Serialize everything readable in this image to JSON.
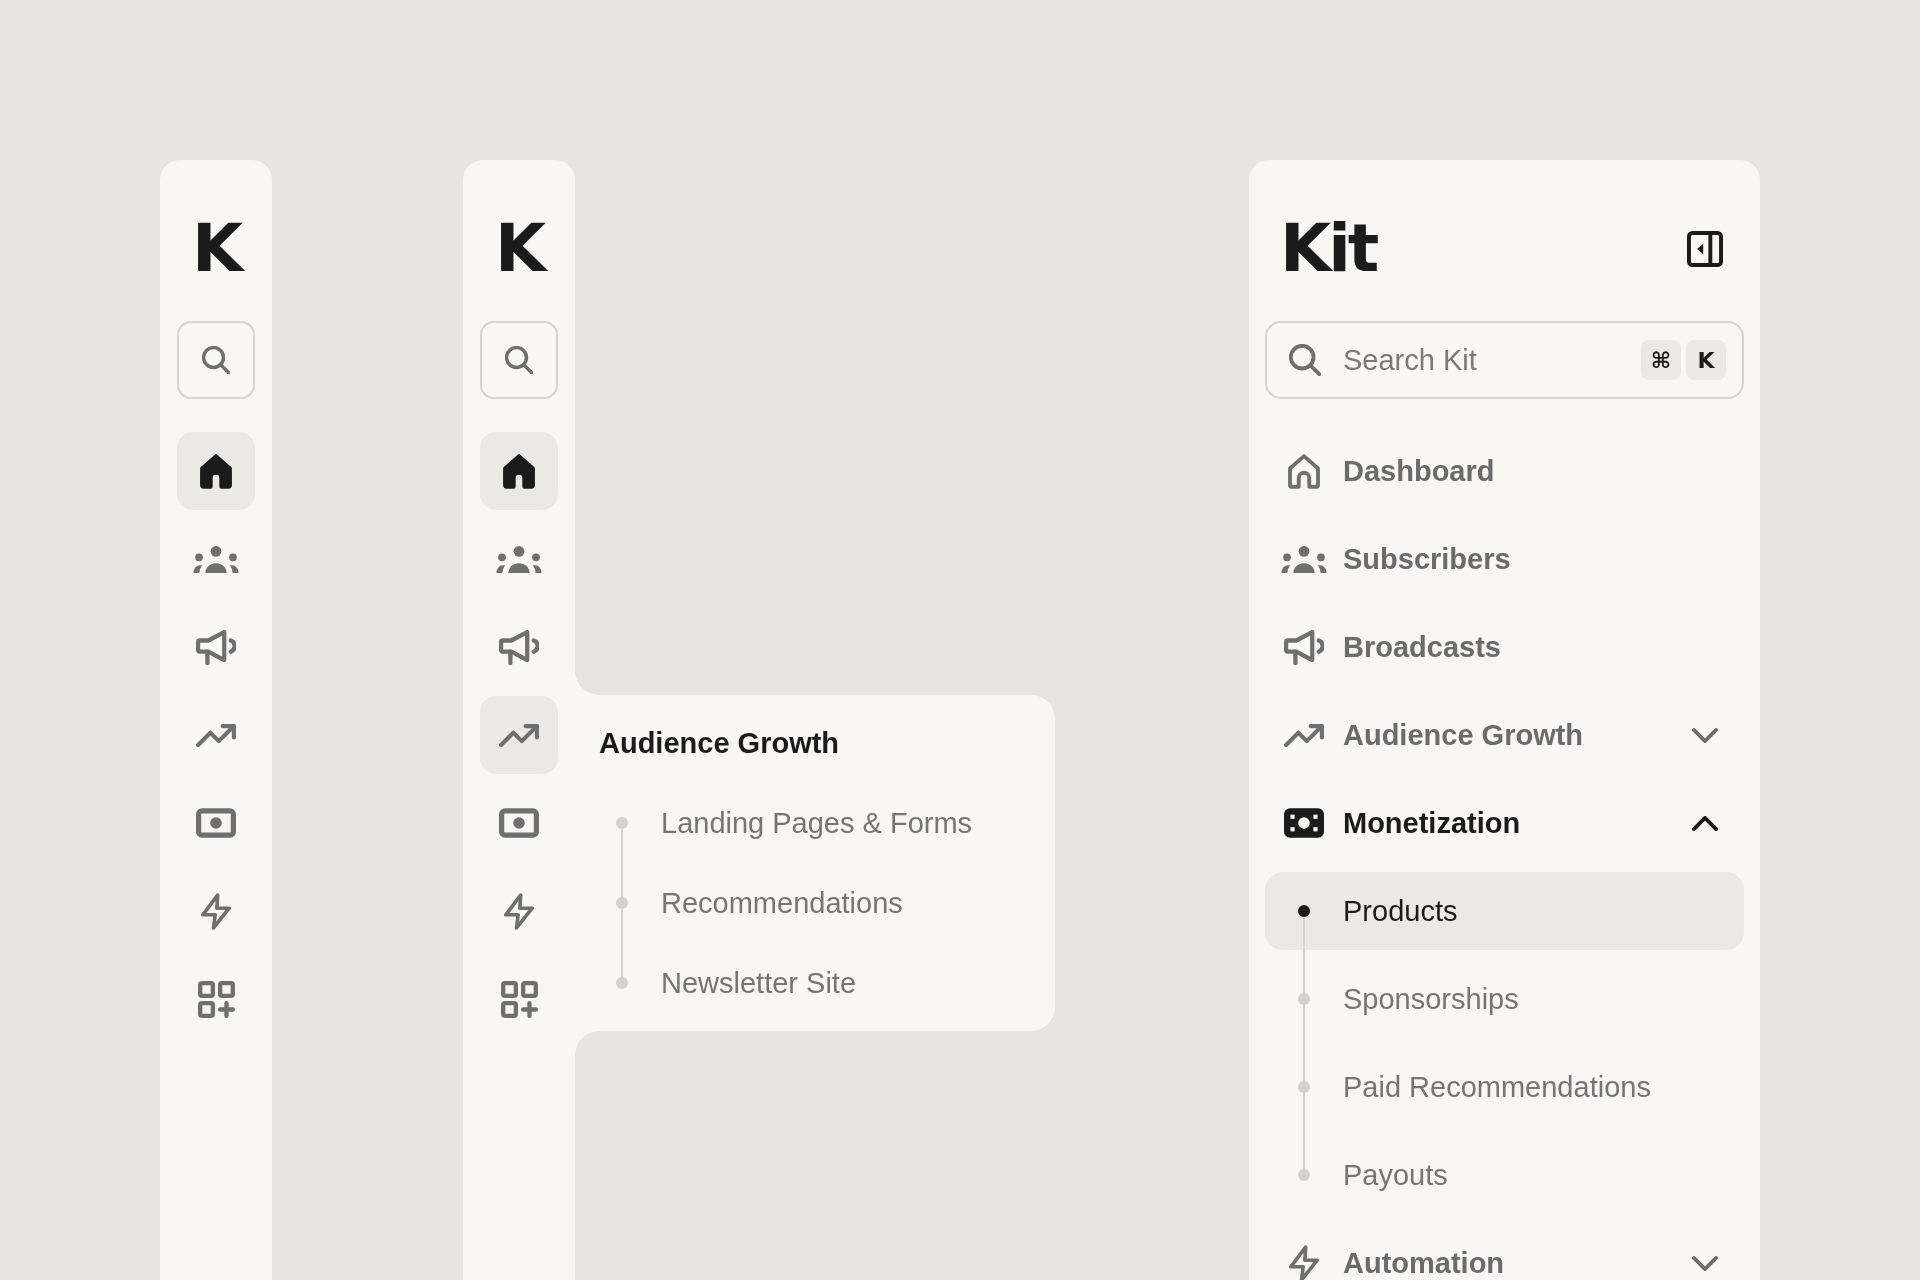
{
  "collapsed_rail": {
    "logo": "K",
    "items": [
      {
        "selected": true
      },
      {
        "selected": false
      },
      {
        "selected": false
      },
      {
        "selected": false
      },
      {
        "selected": false
      },
      {
        "selected": false
      },
      {
        "selected": false
      }
    ]
  },
  "rail_with_flyout": {
    "logo": "K",
    "items": [
      {
        "selected": true,
        "expanded": false
      },
      {
        "selected": false,
        "expanded": false
      },
      {
        "selected": false,
        "expanded": false
      },
      {
        "selected": false,
        "expanded": true
      },
      {
        "selected": false,
        "expanded": false
      },
      {
        "selected": false,
        "expanded": false
      },
      {
        "selected": false,
        "expanded": false
      }
    ],
    "flyout": {
      "title": "Audience Growth",
      "items": [
        {
          "label": "Landing Pages & Forms",
          "selected": false
        },
        {
          "label": "Recommendations",
          "selected": false
        },
        {
          "label": "Newsletter Site",
          "selected": false
        }
      ]
    }
  },
  "expanded_sidebar": {
    "logo": "Kit",
    "search": {
      "placeholder": "Search Kit",
      "shortcut": [
        "⌘",
        "K"
      ]
    },
    "items": [
      {
        "label": "Dashboard",
        "kind": "link",
        "selected": false
      },
      {
        "label": "Subscribers",
        "kind": "link",
        "selected": false
      },
      {
        "label": "Broadcasts",
        "kind": "link",
        "selected": false
      },
      {
        "label": "Audience Growth",
        "kind": "group",
        "expanded": false
      },
      {
        "label": "Monetization",
        "kind": "group",
        "expanded": true,
        "children": [
          {
            "label": "Products",
            "selected": true
          },
          {
            "label": "Sponsorships",
            "selected": false
          },
          {
            "label": "Paid Recommendations",
            "selected": false
          },
          {
            "label": "Payouts",
            "selected": false
          }
        ]
      },
      {
        "label": "Automation",
        "kind": "group",
        "expanded": false
      }
    ]
  }
}
